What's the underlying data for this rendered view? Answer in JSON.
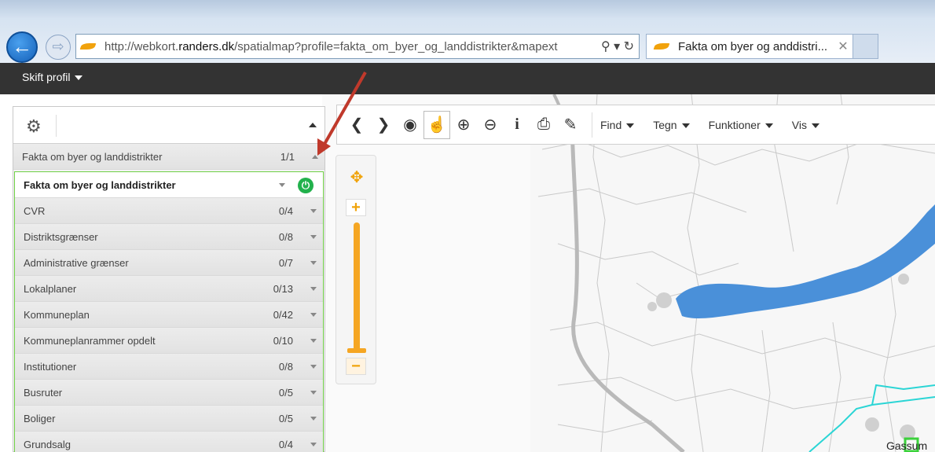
{
  "browser": {
    "url_prefix": "http://webkort.",
    "url_host": "randers.dk",
    "url_rest": "/spatialmap?profile=fakta_om_byer_og_landdistrikter&mapext",
    "address_icons": "⚲ ▾ ↻",
    "tab_title": "Fakta om byer og anddistri...",
    "tab_close": "✕"
  },
  "app_bar": {
    "profile_menu": "Skift profil"
  },
  "panel": {
    "group_header": {
      "label": "Fakta om byer og landdistrikter",
      "count": "1/1"
    },
    "selected_layer": {
      "label": "Fakta om byer og landdistrikter",
      "power": "⏻"
    },
    "layers": [
      {
        "label": "CVR",
        "count": "0/4"
      },
      {
        "label": "Distriktsgrænser",
        "count": "0/8"
      },
      {
        "label": "Administrative grænser",
        "count": "0/7"
      },
      {
        "label": "Lokalplaner",
        "count": "0/13"
      },
      {
        "label": "Kommuneplan",
        "count": "0/42"
      },
      {
        "label": "Kommuneplanrammer opdelt",
        "count": "0/10"
      },
      {
        "label": "Institutioner",
        "count": "0/8"
      },
      {
        "label": "Busruter",
        "count": "0/5"
      },
      {
        "label": "Boliger",
        "count": "0/5"
      },
      {
        "label": "Grundsalg",
        "count": "0/4"
      }
    ]
  },
  "toolbar": {
    "icons": {
      "back": "❮",
      "forward": "❯",
      "globe": "◉",
      "pan": "☝",
      "zoom_in": "⊕",
      "zoom_out": "⊖",
      "info": "i",
      "print": "⎙",
      "measure": "✎"
    },
    "menus": {
      "find": "Find",
      "draw": "Tegn",
      "functions": "Funktioner",
      "view": "Vis"
    }
  },
  "zoom": {
    "pan_symbol": "✥",
    "plus": "+",
    "minus": "−",
    "level": 0.05
  },
  "map": {
    "place_label": "Gassum",
    "lake_color": "#4a90d9",
    "accent": "#f5a623"
  }
}
